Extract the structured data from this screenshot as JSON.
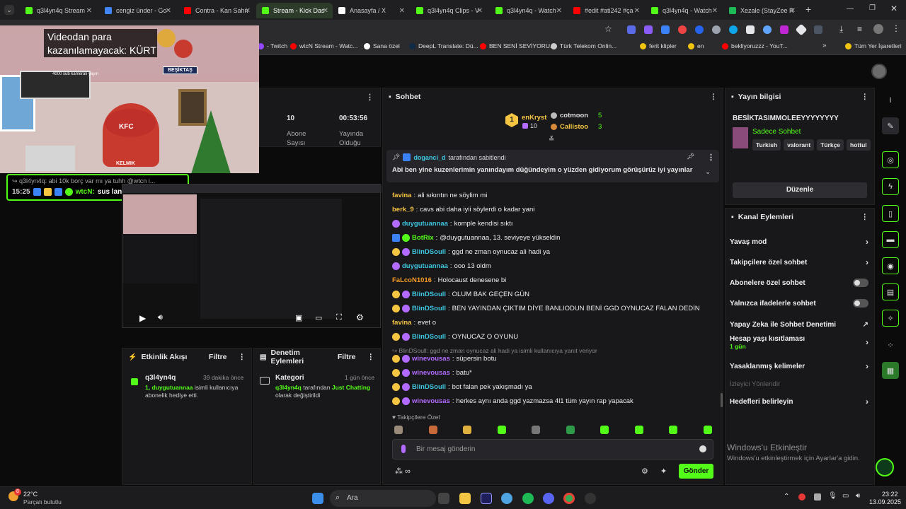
{
  "browser": {
    "tabs": [
      {
        "label": "q3l4yn4q Stream",
        "color": "#53fc18"
      },
      {
        "label": "cengiz ünder - Go",
        "color": "#4285f4"
      },
      {
        "label": "Contra - Kan Sahn",
        "color": "#ff0000"
      },
      {
        "label": "Stream - Kick Das",
        "color": "#53fc18"
      },
      {
        "label": "Anasayfa / X",
        "color": "#ffffff"
      },
      {
        "label": "q3l4yn4q Clips - V",
        "color": "#53fc18"
      },
      {
        "label": "q3l4yn4q - Watch",
        "color": "#53fc18"
      },
      {
        "label": "#edit #ati242 #ça",
        "color": "#ff0000"
      },
      {
        "label": "q3l4yn4q - Watch",
        "color": "#53fc18"
      },
      {
        "label": "Xezale (StayZee R",
        "color": "#1db954"
      }
    ],
    "new_tab": "+",
    "bookmarks": [
      {
        "label": "- Twitch",
        "color": "#9146ff"
      },
      {
        "label": "wtcN Stream - Watc...",
        "color": "#ff0000"
      },
      {
        "label": "Sana özel",
        "color": "#ffffff"
      },
      {
        "label": "DeepL Translate: Dü...",
        "color": "#0f2b46"
      },
      {
        "label": "BEN SENİ SEVİYORU...",
        "color": "#ff0000"
      },
      {
        "label": "Türk Telekom Onlin...",
        "color": "#cccccc"
      },
      {
        "label": "ferit klipler",
        "color": "#f1c40f"
      },
      {
        "label": "en",
        "color": "#f1c40f"
      },
      {
        "label": "bekliyoruzzz - YouT...",
        "color": "#ff0000"
      },
      {
        "label": "Tüm Yer İşaretleri",
        "color": "#f1c40f"
      }
    ],
    "more": "»"
  },
  "overlay": {
    "notice": "Videodan para\nkazanılamayacak: KÜRT",
    "cam_caption": "4000 sub kameralı yayın",
    "besiktas": "BEŞİKTAŞ",
    "kfc": "KFC",
    "kelmik": "KELMIK",
    "reply_line": "q3l4yn4q: abi 10k borç var mı ya tuhh @wtcn i...",
    "time": "15:25",
    "user": "wtcN:",
    "message": "sus lan çalış"
  },
  "stream_stats": {
    "viewers": "10",
    "viewers_label": "Abone\nSayısı",
    "duration": "00:53:56",
    "duration_label": "Yayında\nOlduğu"
  },
  "activity": {
    "title": "Etkinlik Akışı",
    "filter": "Filtre",
    "user": "q3l4yn4q",
    "time": "39 dakika önce",
    "line1": "1, duygutuannaa",
    "line1b": " isimli kullanıcıya",
    "line2": "abonelik hediye etti."
  },
  "moderation": {
    "title": "Denetim Eylemleri",
    "filter": "Filtre",
    "item": "Kategori",
    "time": "1 gün önce",
    "actor": "q3l4yn4q",
    "text": " tarafından ",
    "target": "Just Chatting",
    "line2": "olarak değiştirildi"
  },
  "chat": {
    "title": "Sohbet",
    "leaderboard": [
      {
        "name": "enKryst",
        "count": "10",
        "rank": "1",
        "color": "#f5c542"
      },
      {
        "name": "cotmoon",
        "count": "5",
        "color": "#bbbbbb"
      },
      {
        "name": "Callistoo",
        "count": "3",
        "color": "#f5c542"
      }
    ],
    "pinned_by": "doganci_d",
    "pinned_suffix": "tarafından sabitlendi",
    "pinned_text": "Abi ben yine kuzenlerimin yanındayım düğündeyim o yüzden gidiyorum görüşürüz iyi yayınlar",
    "messages": [
      {
        "user": "favina",
        "text": "ali sıkıntın ne söylim mi",
        "color": "#f5c542"
      },
      {
        "user": "berk_9",
        "text": "cavs abi daha iyii söylerdi o kadar yani",
        "color": "#f5c542"
      },
      {
        "user": "duygutuannaa",
        "text": "komple kendisi sıktı",
        "color": "#3ec6e0"
      },
      {
        "user": "BotRix",
        "text": "@duygutuannaa, 13. seviyeye yükseldin",
        "color": "#53fc18"
      },
      {
        "user": "BlinDSoull",
        "text": "ggd ne zman oynucaz ali hadi ya",
        "color": "#3ec6e0"
      },
      {
        "user": "duygutuannaa",
        "text": "ooo 13 oldm",
        "color": "#3ec6e0"
      },
      {
        "user": "FaLcoN1016",
        "text": "Holocaust denesene bi",
        "color": "#f59b24"
      },
      {
        "user": "BlinDSoull",
        "text": "OLUM BAK GEÇEN GÜN",
        "color": "#3ec6e0"
      },
      {
        "user": "BlinDSoull",
        "text": "BEN YAYINDAN ÇIKTIM DİYE BANLIODUN BENİ GGD OYNUCAZ FALAN DEDİN",
        "color": "#3ec6e0"
      },
      {
        "user": "favina",
        "text": "evet o",
        "color": "#f5c542"
      },
      {
        "user": "BlinDSoull",
        "text": "OYNUCAZ O OYUNU",
        "color": "#3ec6e0"
      },
      {
        "user": "winevousas",
        "text": "süpersin botu",
        "color": "#b36bff"
      },
      {
        "user": "winevousas",
        "text": "batu*",
        "color": "#b36bff"
      },
      {
        "user": "BlinDSoull",
        "text": "bot falan pek yakışmadı ya",
        "color": "#3ec6e0"
      },
      {
        "user": "winevousas",
        "text": "herkes aynı anda ggd yazmazsa 4l1 tüm yayın rap yapacak",
        "color": "#b36bff"
      }
    ],
    "reply_ctx": "BlinDSoull: ggd ne zman oynucaz ali hadi ya isimli kullanıcıya yanıt veriyor",
    "followers_only": "Takipçilere Özel",
    "input_placeholder": "Bir mesaj gönderin",
    "send": "Gönder"
  },
  "stream_info": {
    "title": "Yayın bilgisi",
    "stream_title": "BESİKTASIMMOLEEYYYYYYYY",
    "category": "Sadece Sohbet",
    "tags": [
      "Turkish",
      "valorant",
      "Türkçe",
      "hottul"
    ],
    "edit": "Düzenle"
  },
  "channel_actions": {
    "title": "Kanal Eylemleri",
    "rows": [
      {
        "label": "Yavaş mod",
        "kind": "chevron"
      },
      {
        "label": "Takipçilere özel sohbet",
        "kind": "chevron"
      },
      {
        "label": "Abonelere özel sohbet",
        "kind": "toggle"
      },
      {
        "label": "Yalnızca ifadelerle sohbet",
        "kind": "toggle"
      },
      {
        "label": "Yapay Zeka ile Sohbet Denetimi",
        "kind": "ext"
      },
      {
        "label": "Hesap yaşı kısıtlaması",
        "kind": "chevron",
        "sub": "1 gün"
      },
      {
        "label": "Yasaklanmış kelimeler",
        "kind": "chevron"
      },
      {
        "label": "İzleyici Yönlendir",
        "kind": "disabled"
      },
      {
        "label": "Hedefleri belirleyin",
        "kind": "chevron"
      }
    ]
  },
  "windows_watermark": {
    "title": "Windows'u Etkinleştir",
    "text": "Windows'u etkinleştirmek için Ayarlar'a gidin."
  },
  "taskbar": {
    "weather_temp": "22°C",
    "weather_text": "Parçalı bulutlu",
    "weather_badge": "8",
    "search": "Ara",
    "time": "23:22",
    "date": "13.09.2025"
  },
  "colors": {
    "kick_green": "#53fc18",
    "panel": "#18181b",
    "bg": "#0b0b0c"
  }
}
